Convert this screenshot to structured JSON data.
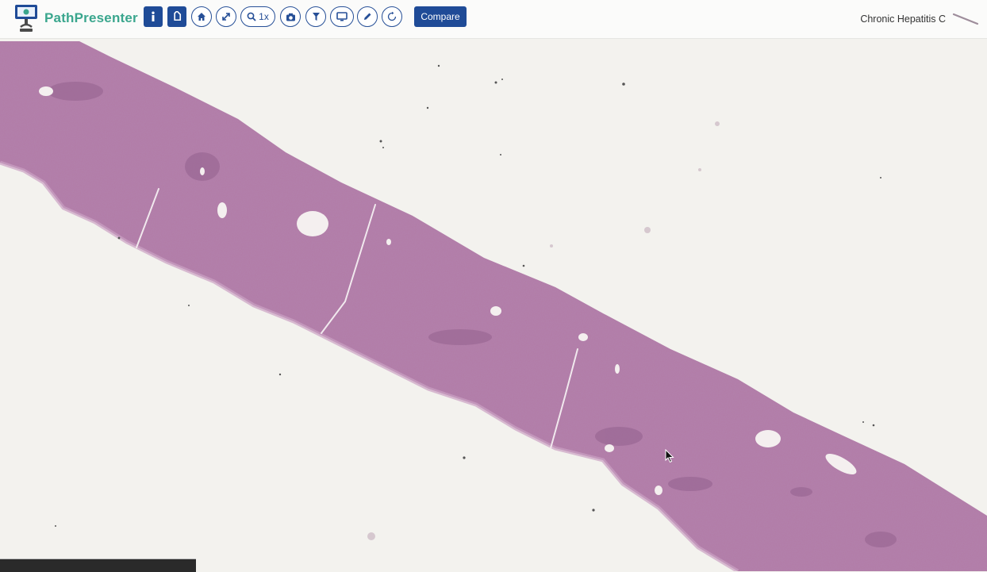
{
  "app": {
    "name": "PathPresenter"
  },
  "toolbar": {
    "tools": [
      {
        "name": "info-icon"
      },
      {
        "name": "tag-icon"
      },
      {
        "name": "home-icon"
      },
      {
        "name": "fullscreen-icon"
      },
      {
        "name": "zoom-icon",
        "label": "1x"
      },
      {
        "name": "camera-icon"
      },
      {
        "name": "filter-icon"
      },
      {
        "name": "monitor-icon"
      },
      {
        "name": "pencil-icon"
      },
      {
        "name": "rotate-icon"
      }
    ],
    "compare_label": "Compare"
  },
  "case": {
    "title": "Chronic Hepatitis C"
  },
  "colors": {
    "brand": "#3aa68d",
    "primary": "#1f4b97",
    "tissue": "#b27aa6",
    "background": "#f3f2ee"
  }
}
